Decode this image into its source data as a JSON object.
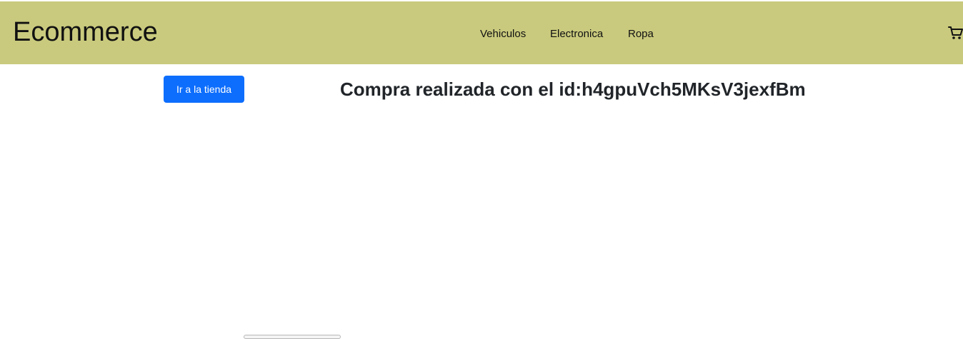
{
  "navbar": {
    "brand": "Ecommerce",
    "links": [
      {
        "label": "Vehiculos"
      },
      {
        "label": "Electronica"
      },
      {
        "label": "Ropa"
      }
    ],
    "cart_icon": "cart-icon"
  },
  "main": {
    "store_button_label": "Ir a la tienda",
    "headline": "Compra realizada con el id:h4gpuVch5MKsV3jexfBm"
  },
  "colors": {
    "navbar_background": "#c9ca7d",
    "primary_button": "#0d6efd",
    "text": "#212529"
  }
}
